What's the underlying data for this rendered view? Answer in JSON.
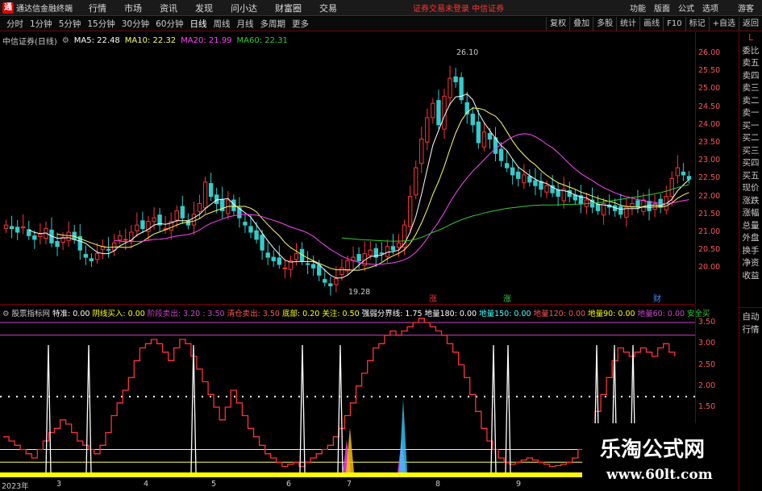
{
  "titlebar": {
    "app_title": "通达信金融终端",
    "menus": [
      "行情",
      "市场",
      "资讯",
      "发现",
      "问小达",
      "财富圈",
      "交易"
    ],
    "notice": "证券交易未登录  中信证券",
    "right": [
      "功能",
      "版面",
      "公式",
      "选项"
    ],
    "guest": "游客"
  },
  "tabs": [
    "分时",
    "1分钟",
    "5分钟",
    "15分钟",
    "30分钟",
    "60分钟",
    "日线",
    "周线",
    "月线",
    "多周期",
    "更多"
  ],
  "active_tab": "日线",
  "right_tools": [
    "复权",
    "叠加",
    "多股",
    "统计",
    "画线",
    "F10",
    "标记",
    "+自选",
    "返回"
  ],
  "main_info": {
    "stock": "中信证券(日线)",
    "ma5": "MA5: 22.48",
    "ma10": "MA10: 22.32",
    "ma20": "MA20: 21.99",
    "ma60": "MA60: 22.31"
  },
  "price_ticks": [
    "26.00",
    "25.50",
    "25.00",
    "24.50",
    "24.00",
    "23.50",
    "23.00",
    "22.50",
    "22.00",
    "21.50",
    "21.00",
    "20.50",
    "20.00"
  ],
  "high_label": "26.10",
  "low_label": "19.28",
  "events": [
    "涨",
    "涨",
    "财"
  ],
  "indicator": {
    "name": "股票指标网",
    "items": [
      {
        "t": "特准: 0.00",
        "c": "#ffffff"
      },
      {
        "t": "阴线买入: 0.00",
        "c": "#ffff00"
      },
      {
        "t": "阶段卖出: 3.20 : 3.50",
        "c": "#cc44cc"
      },
      {
        "t": "清仓卖出: 3.50",
        "c": "#ff5555"
      },
      {
        "t": "底部: 0.20",
        "c": "#ffff00"
      },
      {
        "t": "关注: 0.50",
        "c": "#ffff00"
      },
      {
        "t": "强弱分界线: 1.75",
        "c": "#ffffff"
      },
      {
        "t": "地量180: 0.00",
        "c": "#ffffff"
      },
      {
        "t": "地量150: 0.00",
        "c": "#44ffff"
      },
      {
        "t": "地量120: 0.00",
        "c": "#ff5555"
      },
      {
        "t": "地量90: 0.00",
        "c": "#ffff00"
      },
      {
        "t": "地量60: 0.00",
        "c": "#cc44cc"
      },
      {
        "t": "安全买",
        "c": "#33cc33"
      }
    ]
  },
  "ind_ticks": [
    "3.50",
    "3.00",
    "2.50",
    "2.00",
    "1.50"
  ],
  "dates": [
    "2023年",
    "3",
    "4",
    "5",
    "6",
    "7",
    "8",
    "9"
  ],
  "right_panel": [
    "委比",
    "卖五",
    "卖四",
    "卖三",
    "卖二",
    "卖一",
    "买一",
    "买二",
    "买三",
    "买四",
    "买五",
    "现价",
    "涨跌",
    "涨幅",
    "总量",
    "外盘",
    "换手",
    "净资",
    "收益"
  ],
  "right_panel2": [
    "自动",
    "行情"
  ],
  "l_badge": "L",
  "watermark": {
    "line1": "乐淘公式网",
    "line2": "www.60lt.com"
  },
  "colors": {
    "up": "#ff3333",
    "down": "#33cccc",
    "ma5": "#ffffff",
    "ma10": "#ffff66",
    "ma20": "#ff44ff",
    "ma60": "#33cc33"
  }
}
